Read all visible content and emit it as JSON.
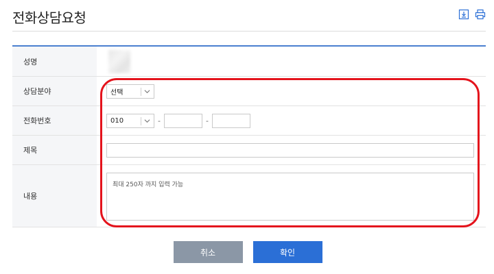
{
  "page": {
    "title": "전화상담요청"
  },
  "header_icons": [
    {
      "icon": "download-icon"
    },
    {
      "icon": "print-icon"
    }
  ],
  "form": {
    "name": {
      "label": "성명"
    },
    "field": {
      "label": "상담분야",
      "selected": "선택"
    },
    "phone": {
      "label": "전화번호",
      "prefix": "010",
      "sep1": "-",
      "sep2": "-"
    },
    "subject": {
      "label": "제목"
    },
    "content": {
      "label": "내용",
      "placeholder": "최대 250자 까지 입력 가능"
    }
  },
  "buttons": {
    "cancel": "취소",
    "confirm": "확인"
  },
  "colors": {
    "accent": "#2b6fd6",
    "cancel": "#8b97a6",
    "highlight": "#e4131c",
    "table_top": "#4a7fcf"
  }
}
